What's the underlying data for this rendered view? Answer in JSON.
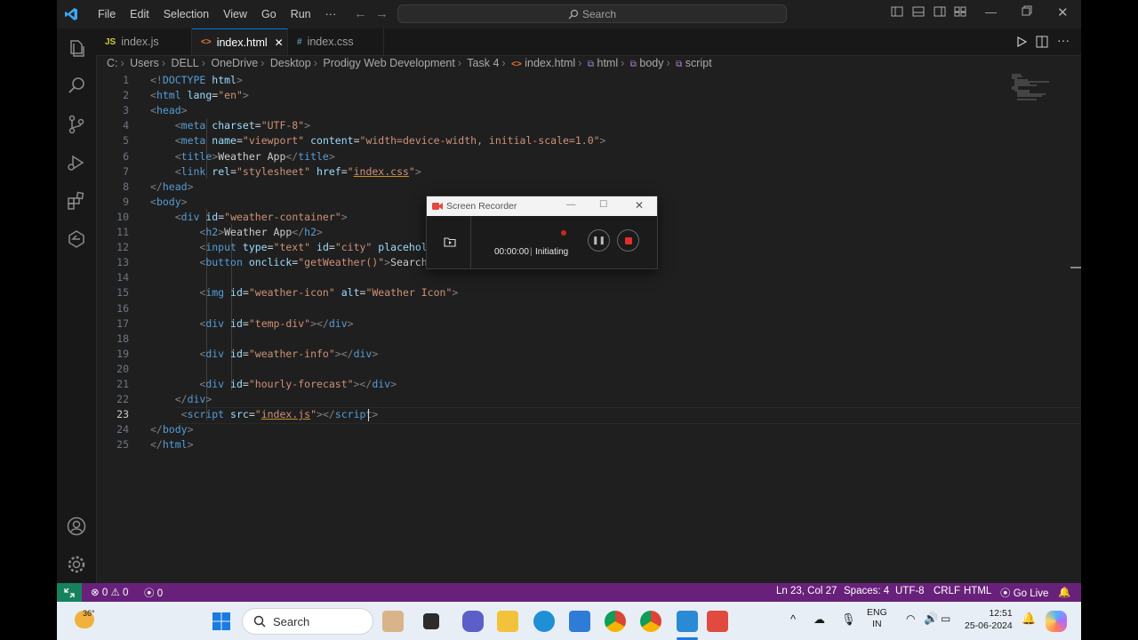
{
  "titlebar": {
    "menu": [
      "File",
      "Edit",
      "Selection",
      "View",
      "Go",
      "Run",
      "···"
    ],
    "search_placeholder": "Search"
  },
  "tabs": [
    {
      "icon": "JS",
      "label": "index.js",
      "icon_color": "#cbcb41"
    },
    {
      "icon": "<>",
      "label": "index.html",
      "icon_color": "#e37933",
      "close": "✕"
    },
    {
      "icon": "#",
      "label": "index.css",
      "icon_color": "#519aba"
    }
  ],
  "breadcrumb": [
    "C:",
    "Users",
    "DELL",
    "OneDrive",
    "Desktop",
    "Prodigy Web Development",
    "Task 4",
    "index.html",
    "html",
    "body",
    "script"
  ],
  "editor": {
    "current_line": 23,
    "lines": [
      {
        "n": "1"
      },
      {
        "n": "2"
      },
      {
        "n": "3"
      },
      {
        "n": "4"
      },
      {
        "n": "5"
      },
      {
        "n": "6"
      },
      {
        "n": "7"
      },
      {
        "n": "8"
      },
      {
        "n": "9"
      },
      {
        "n": "10"
      },
      {
        "n": "11"
      },
      {
        "n": "12"
      },
      {
        "n": "13"
      },
      {
        "n": "14"
      },
      {
        "n": "15"
      },
      {
        "n": "16"
      },
      {
        "n": "17"
      },
      {
        "n": "18"
      },
      {
        "n": "19"
      },
      {
        "n": "20"
      },
      {
        "n": "21"
      },
      {
        "n": "22"
      },
      {
        "n": "23"
      },
      {
        "n": "24"
      },
      {
        "n": "25"
      }
    ]
  },
  "code_tokens": [
    [
      [
        "t",
        "<!"
      ],
      [
        "tg",
        "DOCTYPE"
      ],
      [
        "tx",
        " "
      ],
      [
        "at",
        "html"
      ],
      [
        "t",
        ">"
      ]
    ],
    [
      [
        "t",
        "<"
      ],
      [
        "tg",
        "html"
      ],
      [
        "tx",
        " "
      ],
      [
        "at",
        "lang"
      ],
      [
        "tx",
        "="
      ],
      [
        "st",
        "\"en\""
      ],
      [
        "t",
        ">"
      ]
    ],
    [
      [
        "t",
        "<"
      ],
      [
        "tg",
        "head"
      ],
      [
        "t",
        ">"
      ]
    ],
    [
      [
        "tx",
        "    "
      ],
      [
        "t",
        "<"
      ],
      [
        "tg",
        "meta"
      ],
      [
        "tx",
        " "
      ],
      [
        "at",
        "charset"
      ],
      [
        "tx",
        "="
      ],
      [
        "st",
        "\"UTF-8\""
      ],
      [
        "t",
        ">"
      ]
    ],
    [
      [
        "tx",
        "    "
      ],
      [
        "t",
        "<"
      ],
      [
        "tg",
        "meta"
      ],
      [
        "tx",
        " "
      ],
      [
        "at",
        "name"
      ],
      [
        "tx",
        "="
      ],
      [
        "st",
        "\"viewport\""
      ],
      [
        "tx",
        " "
      ],
      [
        "at",
        "content"
      ],
      [
        "tx",
        "="
      ],
      [
        "st",
        "\"width=device-width, initial-scale=1.0\""
      ],
      [
        "t",
        ">"
      ]
    ],
    [
      [
        "tx",
        "    "
      ],
      [
        "t",
        "<"
      ],
      [
        "tg",
        "title"
      ],
      [
        "t",
        ">"
      ],
      [
        "tx",
        "Weather App"
      ],
      [
        "t",
        "</"
      ],
      [
        "tg",
        "title"
      ],
      [
        "t",
        ">"
      ]
    ],
    [
      [
        "tx",
        "    "
      ],
      [
        "t",
        "<"
      ],
      [
        "tg",
        "link"
      ],
      [
        "tx",
        " "
      ],
      [
        "at",
        "rel"
      ],
      [
        "tx",
        "="
      ],
      [
        "st",
        "\"stylesheet\""
      ],
      [
        "tx",
        " "
      ],
      [
        "at",
        "href"
      ],
      [
        "tx",
        "="
      ],
      [
        "st",
        "\""
      ],
      [
        "stu",
        "index.css"
      ],
      [
        "st",
        "\""
      ],
      [
        "t",
        ">"
      ]
    ],
    [
      [
        "t",
        "</"
      ],
      [
        "tg",
        "head"
      ],
      [
        "t",
        ">"
      ]
    ],
    [
      [
        "t",
        "<"
      ],
      [
        "tg",
        "body"
      ],
      [
        "t",
        ">"
      ]
    ],
    [
      [
        "tx",
        "    "
      ],
      [
        "t",
        "<"
      ],
      [
        "tg",
        "div"
      ],
      [
        "tx",
        " "
      ],
      [
        "at",
        "id"
      ],
      [
        "tx",
        "="
      ],
      [
        "st",
        "\"weather-container\""
      ],
      [
        "t",
        ">"
      ]
    ],
    [
      [
        "tx",
        "        "
      ],
      [
        "t",
        "<"
      ],
      [
        "tg",
        "h2"
      ],
      [
        "t",
        ">"
      ],
      [
        "tx",
        "Weather App"
      ],
      [
        "t",
        "</"
      ],
      [
        "tg",
        "h2"
      ],
      [
        "t",
        ">"
      ]
    ],
    [
      [
        "tx",
        "        "
      ],
      [
        "t",
        "<"
      ],
      [
        "tg",
        "input"
      ],
      [
        "tx",
        " "
      ],
      [
        "at",
        "type"
      ],
      [
        "tx",
        "="
      ],
      [
        "st",
        "\"text\""
      ],
      [
        "tx",
        " "
      ],
      [
        "at",
        "id"
      ],
      [
        "tx",
        "="
      ],
      [
        "st",
        "\"city\""
      ],
      [
        "tx",
        " "
      ],
      [
        "at",
        "placehol"
      ]
    ],
    [
      [
        "tx",
        "        "
      ],
      [
        "t",
        "<"
      ],
      [
        "tg",
        "button"
      ],
      [
        "tx",
        " "
      ],
      [
        "at",
        "onclick"
      ],
      [
        "tx",
        "="
      ],
      [
        "st",
        "\"getWeather()\""
      ],
      [
        "t",
        ">"
      ],
      [
        "tx",
        "Search"
      ]
    ],
    [],
    [
      [
        "tx",
        "        "
      ],
      [
        "t",
        "<"
      ],
      [
        "tg",
        "img"
      ],
      [
        "tx",
        " "
      ],
      [
        "at",
        "id"
      ],
      [
        "tx",
        "="
      ],
      [
        "st",
        "\"weather-icon\""
      ],
      [
        "tx",
        " "
      ],
      [
        "at",
        "alt"
      ],
      [
        "tx",
        "="
      ],
      [
        "st",
        "\"Weather Icon\""
      ],
      [
        "t",
        ">"
      ]
    ],
    [],
    [
      [
        "tx",
        "        "
      ],
      [
        "t",
        "<"
      ],
      [
        "tg",
        "div"
      ],
      [
        "tx",
        " "
      ],
      [
        "at",
        "id"
      ],
      [
        "tx",
        "="
      ],
      [
        "st",
        "\"temp-div\""
      ],
      [
        "t",
        "></"
      ],
      [
        "tg",
        "div"
      ],
      [
        "t",
        ">"
      ]
    ],
    [],
    [
      [
        "tx",
        "        "
      ],
      [
        "t",
        "<"
      ],
      [
        "tg",
        "div"
      ],
      [
        "tx",
        " "
      ],
      [
        "at",
        "id"
      ],
      [
        "tx",
        "="
      ],
      [
        "st",
        "\"weather-info\""
      ],
      [
        "t",
        "></"
      ],
      [
        "tg",
        "div"
      ],
      [
        "t",
        ">"
      ]
    ],
    [],
    [
      [
        "tx",
        "        "
      ],
      [
        "t",
        "<"
      ],
      [
        "tg",
        "div"
      ],
      [
        "tx",
        " "
      ],
      [
        "at",
        "id"
      ],
      [
        "tx",
        "="
      ],
      [
        "st",
        "\"hourly-forecast\""
      ],
      [
        "t",
        "></"
      ],
      [
        "tg",
        "div"
      ],
      [
        "t",
        ">"
      ]
    ],
    [
      [
        "tx",
        "    "
      ],
      [
        "t",
        "</"
      ],
      [
        "tg",
        "div"
      ],
      [
        "t",
        ">"
      ]
    ],
    [
      [
        "tx",
        "     "
      ],
      [
        "t",
        "<"
      ],
      [
        "tg",
        "script"
      ],
      [
        "tx",
        " "
      ],
      [
        "at",
        "src"
      ],
      [
        "tx",
        "="
      ],
      [
        "st",
        "\""
      ],
      [
        "stu",
        "index.js"
      ],
      [
        "st",
        "\""
      ],
      [
        "t",
        "></"
      ],
      [
        "tg",
        "script"
      ],
      [
        "t",
        ">"
      ]
    ],
    [
      [
        "t",
        "</"
      ],
      [
        "tg",
        "body"
      ],
      [
        "t",
        ">"
      ]
    ],
    [
      [
        "t",
        "</"
      ],
      [
        "tg",
        "html"
      ],
      [
        "t",
        ">"
      ]
    ]
  ],
  "recorder": {
    "title": "Screen Recorder",
    "time": "00:00:00",
    "status": "Initiating"
  },
  "statusbar": {
    "errors": "0",
    "warnings": "0",
    "ports": "0",
    "position": "Ln 23, Col 27",
    "spaces": "Spaces: 4",
    "encoding": "UTF-8",
    "eol": "CRLF",
    "language": "HTML",
    "golive": "Go Live"
  },
  "taskbar": {
    "weather_temp": "36°",
    "search_label": "Search",
    "lang_top": "ENG",
    "lang_bottom": "IN",
    "time": "12:51",
    "date": "25-06-2024"
  },
  "colors": {
    "accent": "#0078d4",
    "statusbar": "#68217a",
    "remote": "#16825d"
  }
}
